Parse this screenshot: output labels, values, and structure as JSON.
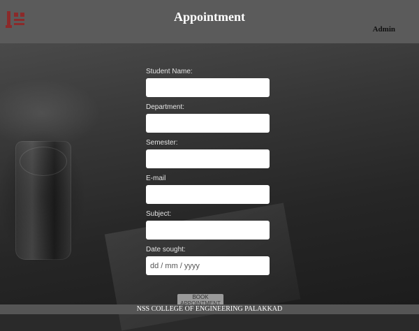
{
  "header": {
    "title": "Appointment",
    "admin_link": "Admin",
    "logo_icon": "college-logo-icon"
  },
  "form": {
    "fields": [
      {
        "label": "Student Name:",
        "value": "",
        "type": "text"
      },
      {
        "label": "Department:",
        "value": "",
        "type": "text"
      },
      {
        "label": "Semester:",
        "value": "",
        "type": "text"
      },
      {
        "label": "E-mail",
        "value": "",
        "type": "email"
      },
      {
        "label": "Subject:",
        "value": "",
        "type": "text"
      },
      {
        "label": "Date sought:",
        "value": "",
        "placeholder": "dd / mm / yyyy",
        "type": "date"
      }
    ],
    "submit_label": "BOOK APPOINTMENT"
  },
  "footer": {
    "text": "NSS COLLEGE OF ENGINEERING PALAKKAD"
  },
  "colors": {
    "header_bg": "#5b5b5b",
    "footer_bg": "#555555",
    "logo": "#8b2a2a"
  }
}
